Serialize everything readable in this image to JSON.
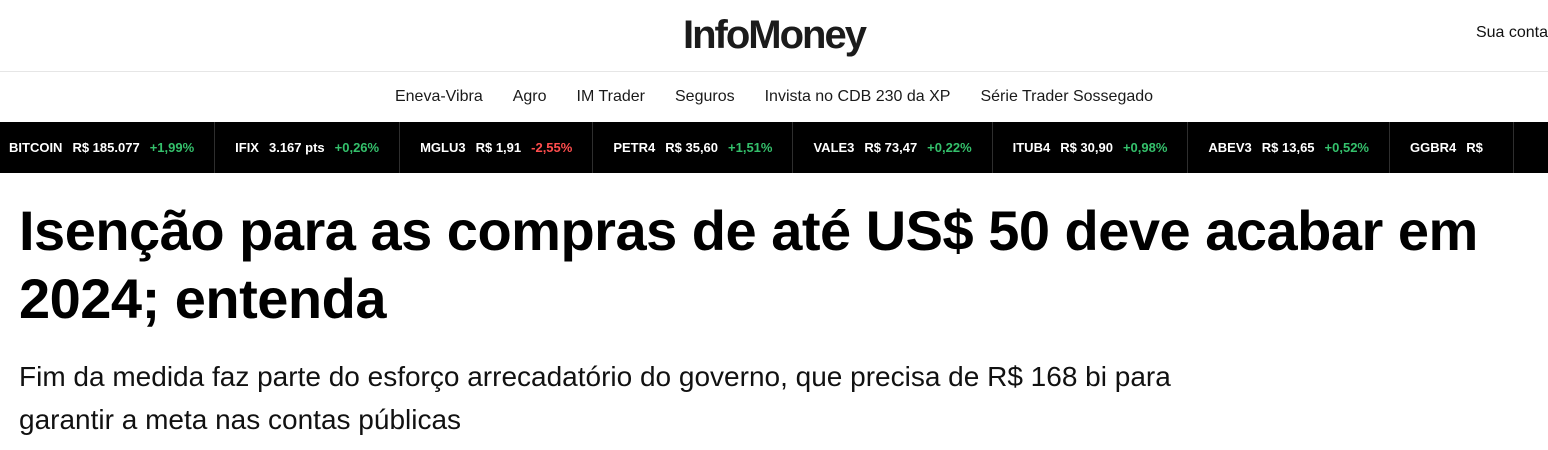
{
  "header": {
    "logo": "InfoMoney",
    "account_label": "Sua conta"
  },
  "nav": {
    "items": [
      {
        "label": "Eneva-Vibra"
      },
      {
        "label": "Agro"
      },
      {
        "label": "IM Trader"
      },
      {
        "label": "Seguros"
      },
      {
        "label": "Invista no CDB 230 da XP"
      },
      {
        "label": "Série Trader Sossegado"
      }
    ]
  },
  "ticker": {
    "items": [
      {
        "symbol": "BITCOIN",
        "price": "R$ 185.077",
        "change": "+1,99%",
        "direction": "up"
      },
      {
        "symbol": "IFIX",
        "price": "3.167 pts",
        "change": "+0,26%",
        "direction": "up"
      },
      {
        "symbol": "MGLU3",
        "price": "R$ 1,91",
        "change": "-2,55%",
        "direction": "down"
      },
      {
        "symbol": "PETR4",
        "price": "R$ 35,60",
        "change": "+1,51%",
        "direction": "up"
      },
      {
        "symbol": "VALE3",
        "price": "R$ 73,47",
        "change": "+0,22%",
        "direction": "up"
      },
      {
        "symbol": "ITUB4",
        "price": "R$ 30,90",
        "change": "+0,98%",
        "direction": "up"
      },
      {
        "symbol": "ABEV3",
        "price": "R$ 13,65",
        "change": "+0,52%",
        "direction": "up"
      },
      {
        "symbol": "GGBR4",
        "price": "R$",
        "change": "",
        "direction": "up"
      }
    ],
    "colors": {
      "up": "#34c06b",
      "down": "#ff4d4d",
      "background": "#000000"
    }
  },
  "article": {
    "title": "Isenção para as compras de até US$ 50 deve acabar em 2024; entenda",
    "subtitle": "Fim da medida faz parte do esforço arrecadatório do governo, que precisa de R$ 168 bi para garantir a meta nas contas públicas"
  }
}
